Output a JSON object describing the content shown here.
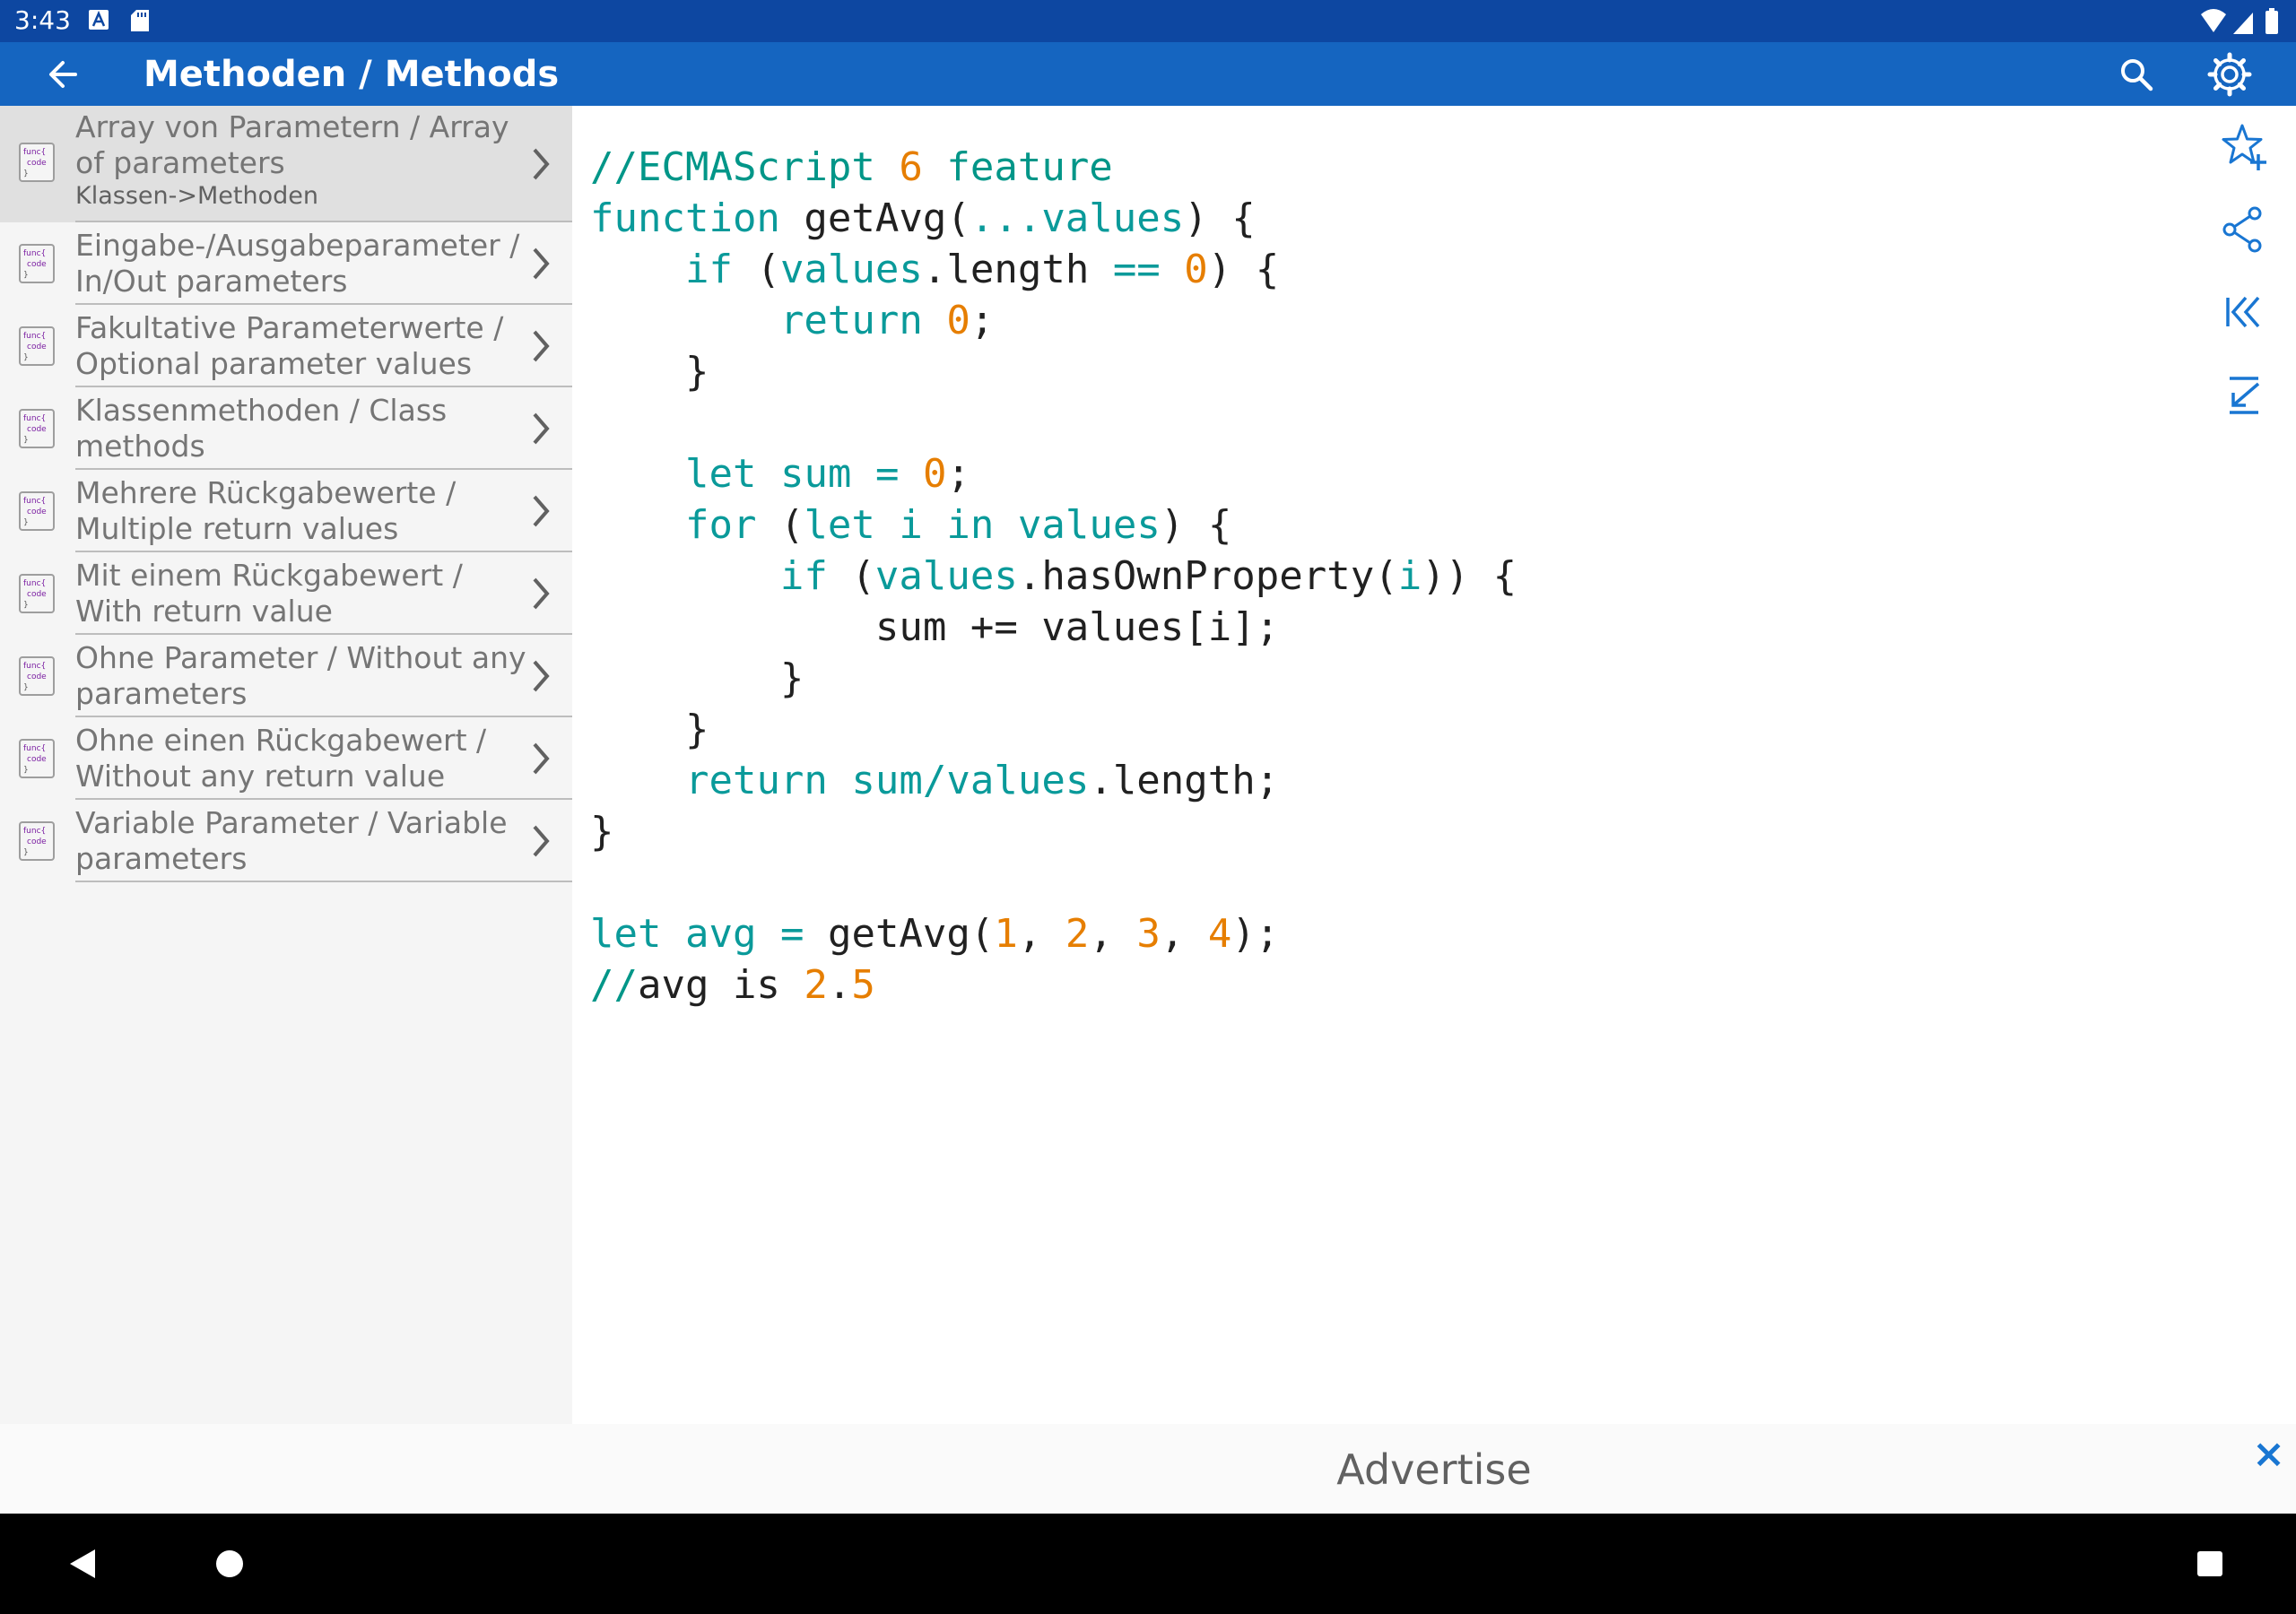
{
  "status_bar": {
    "time": "3:43"
  },
  "app_bar": {
    "title": "Methoden / Methods"
  },
  "sidebar": {
    "items": [
      {
        "label": "Array von Parametern / Array of parameters",
        "subtitle": "Klassen->Methoden",
        "selected": true
      },
      {
        "label": "Eingabe-/Ausgabeparameter / In/Out parameters"
      },
      {
        "label": "Fakultative Parameterwerte / Optional parameter values"
      },
      {
        "label": "Klassenmethoden / Class methods"
      },
      {
        "label": "Mehrere Rückgabewerte / Multiple return values"
      },
      {
        "label": "Mit einem Rückgabewert / With return value"
      },
      {
        "label": "Ohne Parameter / Without any parameters"
      },
      {
        "label": "Ohne einen Rückgabewert / Without any return value"
      },
      {
        "label": "Variable Parameter / Variable parameters"
      }
    ],
    "item_icon": "func-code-icon"
  },
  "code": {
    "lines": [
      [
        [
          "com",
          "//ECMAScript "
        ],
        [
          "num",
          "6"
        ],
        [
          "com",
          " feature"
        ]
      ],
      [
        [
          "kw",
          "function"
        ],
        [
          "d",
          " getAvg("
        ],
        [
          "id",
          "...values"
        ],
        [
          "d",
          ") {"
        ]
      ],
      [
        [
          "d",
          "    "
        ],
        [
          "kw",
          "if"
        ],
        [
          "d",
          " ("
        ],
        [
          "id",
          "values"
        ],
        [
          "d",
          ".length "
        ],
        [
          "id",
          "=="
        ],
        [
          "d",
          " "
        ],
        [
          "num",
          "0"
        ],
        [
          "d",
          ") {"
        ]
      ],
      [
        [
          "d",
          "        "
        ],
        [
          "kw",
          "return"
        ],
        [
          "d",
          " "
        ],
        [
          "num",
          "0"
        ],
        [
          "d",
          ";"
        ]
      ],
      [
        [
          "d",
          "    }"
        ]
      ],
      [
        [
          "d",
          ""
        ]
      ],
      [
        [
          "d",
          "    "
        ],
        [
          "kw",
          "let"
        ],
        [
          "d",
          " "
        ],
        [
          "id",
          "sum"
        ],
        [
          "d",
          " "
        ],
        [
          "id",
          "="
        ],
        [
          "d",
          " "
        ],
        [
          "num",
          "0"
        ],
        [
          "d",
          ";"
        ]
      ],
      [
        [
          "d",
          "    "
        ],
        [
          "kw",
          "for"
        ],
        [
          "d",
          " ("
        ],
        [
          "kw",
          "let"
        ],
        [
          "d",
          " "
        ],
        [
          "id",
          "i"
        ],
        [
          "d",
          " "
        ],
        [
          "kw",
          "in"
        ],
        [
          "d",
          " "
        ],
        [
          "id",
          "values"
        ],
        [
          "d",
          ") {"
        ]
      ],
      [
        [
          "d",
          "        "
        ],
        [
          "kw",
          "if"
        ],
        [
          "d",
          " ("
        ],
        [
          "id",
          "values"
        ],
        [
          "d",
          ".hasOwnProperty("
        ],
        [
          "id",
          "i"
        ],
        [
          "d",
          ")) {"
        ]
      ],
      [
        [
          "d",
          "            sum += values[i];"
        ]
      ],
      [
        [
          "d",
          "        }"
        ]
      ],
      [
        [
          "d",
          "    }"
        ]
      ],
      [
        [
          "d",
          "    "
        ],
        [
          "kw",
          "return"
        ],
        [
          "d",
          " "
        ],
        [
          "id",
          "sum/values"
        ],
        [
          "d",
          ".length;"
        ]
      ],
      [
        [
          "d",
          "}"
        ]
      ],
      [
        [
          "d",
          ""
        ]
      ],
      [
        [
          "kw",
          "let"
        ],
        [
          "d",
          " "
        ],
        [
          "id",
          "avg"
        ],
        [
          "d",
          " "
        ],
        [
          "id",
          "="
        ],
        [
          "d",
          " getAvg("
        ],
        [
          "num",
          "1"
        ],
        [
          "d",
          ", "
        ],
        [
          "num",
          "2"
        ],
        [
          "d",
          ", "
        ],
        [
          "num",
          "3"
        ],
        [
          "d",
          ", "
        ],
        [
          "num",
          "4"
        ],
        [
          "d",
          ");"
        ]
      ],
      [
        [
          "com",
          "//"
        ],
        [
          "d",
          "avg is "
        ],
        [
          "num",
          "2"
        ],
        [
          "d",
          "."
        ],
        [
          "num",
          "5"
        ]
      ]
    ]
  },
  "tools": [
    "star-add-icon",
    "share-icon",
    "first-page-icon",
    "scroll-bottom-icon"
  ],
  "ad": {
    "label": "Advertise",
    "close": "×"
  },
  "colors": {
    "status_bar": "#0d47a1",
    "app_bar": "#1565c0",
    "accent": "#1976d2",
    "keyword": "#0a9a9a",
    "number": "#e67e00"
  }
}
